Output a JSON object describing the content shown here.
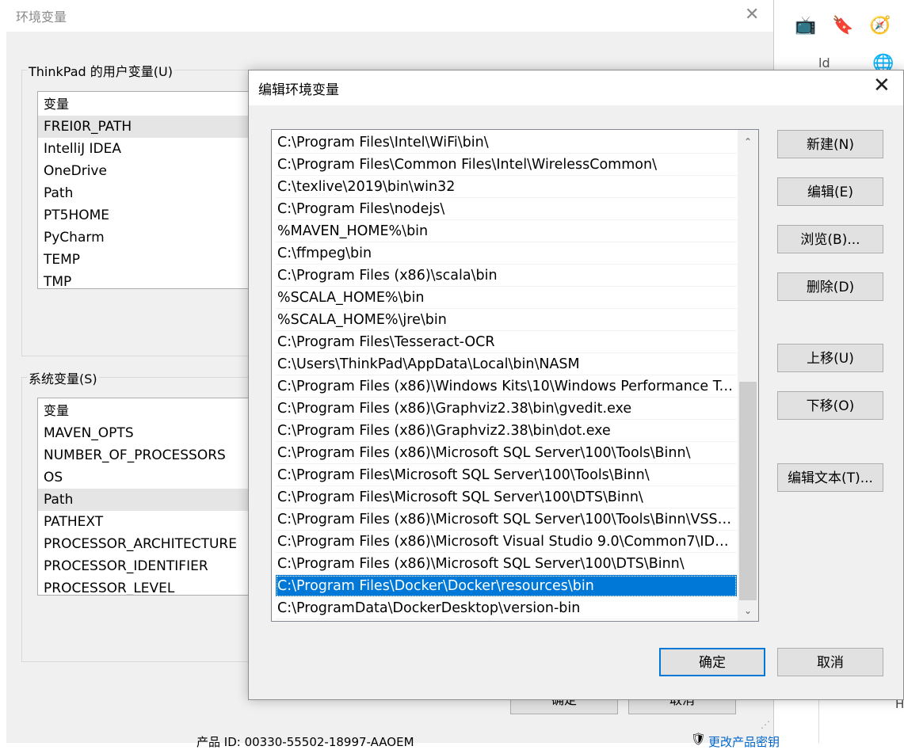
{
  "background_window": {
    "title": "环境变量",
    "close_glyph": "✕",
    "user_vars": {
      "group_label": "ThinkPad 的用户变量(U)",
      "column_header": "变量",
      "selected": "FREI0R_PATH",
      "items": [
        "FREI0R_PATH",
        "IntelliJ IDEA",
        "OneDrive",
        "Path",
        "PT5HOME",
        "PyCharm",
        "TEMP",
        "TMP"
      ]
    },
    "system_vars": {
      "group_label": "系统变量(S)",
      "column_header": "变量",
      "selected": "Path",
      "items": [
        "MAVEN_OPTS",
        "NUMBER_OF_PROCESSORS",
        "OS",
        "Path",
        "PATHEXT",
        "PROCESSOR_ARCHITECTURE",
        "PROCESSOR_IDENTIFIER",
        "PROCESSOR_LEVEL"
      ]
    },
    "ok_label": "确定",
    "cancel_label": "取消",
    "bottom_text": "产品 ID: 00330-55502-18997-AAOEM",
    "bottom_right_link": "更改产品密钥"
  },
  "browser_strip": {
    "partial_text": "ld",
    "partial_letter": "H"
  },
  "dialog": {
    "title": "编辑环境变量",
    "close_glyph": "✕",
    "paths": [
      "C:\\Program Files\\Intel\\WiFi\\bin\\",
      "C:\\Program Files\\Common Files\\Intel\\WirelessCommon\\",
      "C:\\texlive\\2019\\bin\\win32",
      "C:\\Program Files\\nodejs\\",
      "%MAVEN_HOME%\\bin",
      "C:\\ffmpeg\\bin",
      "C:\\Program Files (x86)\\scala\\bin",
      "%SCALA_HOME%\\bin",
      "%SCALA_HOME%\\jre\\bin",
      "C:\\Program Files\\Tesseract-OCR",
      "C:\\Users\\ThinkPad\\AppData\\Local\\bin\\NASM",
      "C:\\Program Files (x86)\\Windows Kits\\10\\Windows Performance To...",
      "C:\\Program Files (x86)\\Graphviz2.38\\bin\\gvedit.exe",
      "C:\\Program Files (x86)\\Graphviz2.38\\bin\\dot.exe",
      "C:\\Program Files (x86)\\Microsoft SQL Server\\100\\Tools\\Binn\\",
      "C:\\Program Files\\Microsoft SQL Server\\100\\Tools\\Binn\\",
      "C:\\Program Files\\Microsoft SQL Server\\100\\DTS\\Binn\\",
      "C:\\Program Files (x86)\\Microsoft SQL Server\\100\\Tools\\Binn\\VSSh...",
      "C:\\Program Files (x86)\\Microsoft Visual Studio 9.0\\Common7\\IDE\\...",
      "C:\\Program Files (x86)\\Microsoft SQL Server\\100\\DTS\\Binn\\",
      "C:\\Program Files\\Docker\\Docker\\resources\\bin",
      "C:\\ProgramData\\DockerDesktop\\version-bin"
    ],
    "selected_index": 20,
    "buttons": {
      "new": "新建(N)",
      "edit": "编辑(E)",
      "browse": "浏览(B)...",
      "delete": "删除(D)",
      "move_up": "上移(U)",
      "move_down": "下移(O)",
      "edit_text": "编辑文本(T)...",
      "ok": "确定",
      "cancel": "取消"
    },
    "scrollbar": {
      "up_glyph": "⌃",
      "down_glyph": "⌄"
    }
  }
}
